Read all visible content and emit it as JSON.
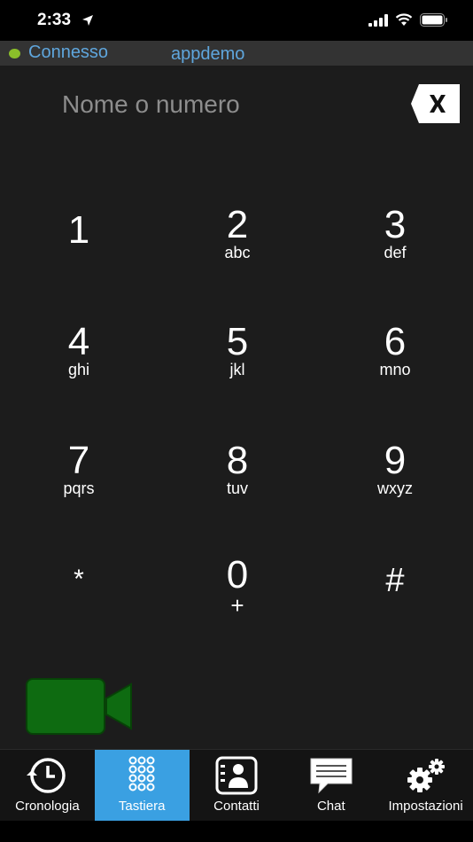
{
  "status_bar": {
    "time": "2:33",
    "icons": [
      "location-arrow-icon",
      "cellular-signal-icon",
      "wifi-icon",
      "battery-icon"
    ]
  },
  "connection": {
    "status": "Connesso",
    "user": "appdemo",
    "status_color": "#8bbf2a"
  },
  "dialer": {
    "input": {
      "value": "",
      "placeholder": "Nome o numero"
    },
    "keys": [
      {
        "digit": "1",
        "letters": ""
      },
      {
        "digit": "2",
        "letters": "abc"
      },
      {
        "digit": "3",
        "letters": "def"
      },
      {
        "digit": "4",
        "letters": "ghi"
      },
      {
        "digit": "5",
        "letters": "jkl"
      },
      {
        "digit": "6",
        "letters": "mno"
      },
      {
        "digit": "7",
        "letters": "pqrs"
      },
      {
        "digit": "8",
        "letters": "tuv"
      },
      {
        "digit": "9",
        "letters": "wxyz"
      },
      {
        "digit": "*",
        "letters": ""
      },
      {
        "digit": "0",
        "letters": "+"
      },
      {
        "digit": "#",
        "letters": ""
      }
    ],
    "video_call_color": "#0e6b11"
  },
  "tabs": [
    {
      "label": "Cronologia",
      "icon": "history-clock-icon",
      "active": false
    },
    {
      "label": "Tastiera",
      "icon": "keypad-icon",
      "active": true
    },
    {
      "label": "Contatti",
      "icon": "contacts-icon",
      "active": false
    },
    {
      "label": "Chat",
      "icon": "chat-bubble-icon",
      "active": false
    },
    {
      "label": "Impostazioni",
      "icon": "gears-icon",
      "active": false
    }
  ],
  "colors": {
    "accent": "#3aa0e2",
    "link": "#5fa6dd",
    "background": "#1c1c1c"
  }
}
